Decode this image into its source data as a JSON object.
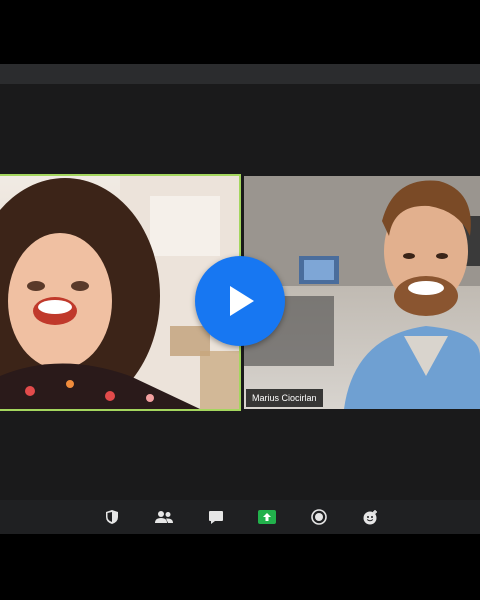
{
  "participants": [
    {
      "name": "",
      "speaking": true
    },
    {
      "name": "Marius Ciocirlan",
      "speaking": false
    }
  ],
  "playback": {
    "icon": "play-icon",
    "color": "#1777f2"
  },
  "toolbar": {
    "items": [
      {
        "icon": "shield-icon"
      },
      {
        "icon": "participants-icon"
      },
      {
        "icon": "chat-icon"
      },
      {
        "icon": "share-screen-icon",
        "active": true
      },
      {
        "icon": "record-icon"
      },
      {
        "icon": "reactions-icon"
      }
    ]
  },
  "colors": {
    "speaker_border": "#a4d65e",
    "share_green": "#22b14c",
    "toolbar_bg": "#1f2022",
    "stage_bg": "#1a1a1b"
  }
}
